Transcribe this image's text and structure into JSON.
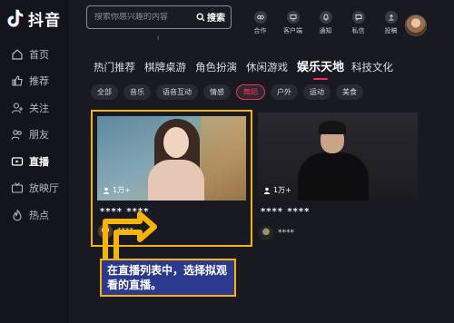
{
  "app": {
    "logo_text": "抖音"
  },
  "sidebar": {
    "items": [
      {
        "label": "首页",
        "icon": "home-icon"
      },
      {
        "label": "推荐",
        "icon": "thumbs-up-icon"
      },
      {
        "label": "关注",
        "icon": "add-user-icon"
      },
      {
        "label": "朋友",
        "icon": "friends-icon"
      },
      {
        "label": "直播",
        "icon": "live-icon",
        "active": true
      },
      {
        "label": "放映厅",
        "icon": "tv-icon"
      },
      {
        "label": "热点",
        "icon": "flame-icon"
      }
    ]
  },
  "search": {
    "placeholder": "搜索你感兴趣的内容",
    "button_label": "搜索"
  },
  "header": {
    "tools": [
      {
        "label": "合作",
        "icon": "cooperate-icon"
      },
      {
        "label": "客户端",
        "icon": "client-icon"
      },
      {
        "label": "通知",
        "icon": "bell-icon"
      },
      {
        "label": "私信",
        "icon": "message-icon"
      },
      {
        "label": "投稿",
        "icon": "upload-icon"
      }
    ]
  },
  "categories": [
    "热门推荐",
    "棋牌桌游",
    "角色扮演",
    "休闲游戏",
    "娱乐天地",
    "科技文化"
  ],
  "active_category": "娱乐天地",
  "tags": [
    "全部",
    "音乐",
    "语音互动",
    "情感",
    "舞蹈",
    "户外",
    "运动",
    "美食"
  ],
  "active_tag": "舞蹈",
  "streams": [
    {
      "viewers": "1万+",
      "title": "**** ****",
      "streamer": "****"
    },
    {
      "viewers": "1万+",
      "title": "**** ****",
      "streamer": "****"
    }
  ],
  "callout": {
    "text": "在直播列表中，选择拟观看的直播。"
  },
  "colors": {
    "accent": "#fe2c55",
    "highlight": "#f7b500",
    "callout_bg": "#2b3a8e",
    "background": "#16161e"
  }
}
